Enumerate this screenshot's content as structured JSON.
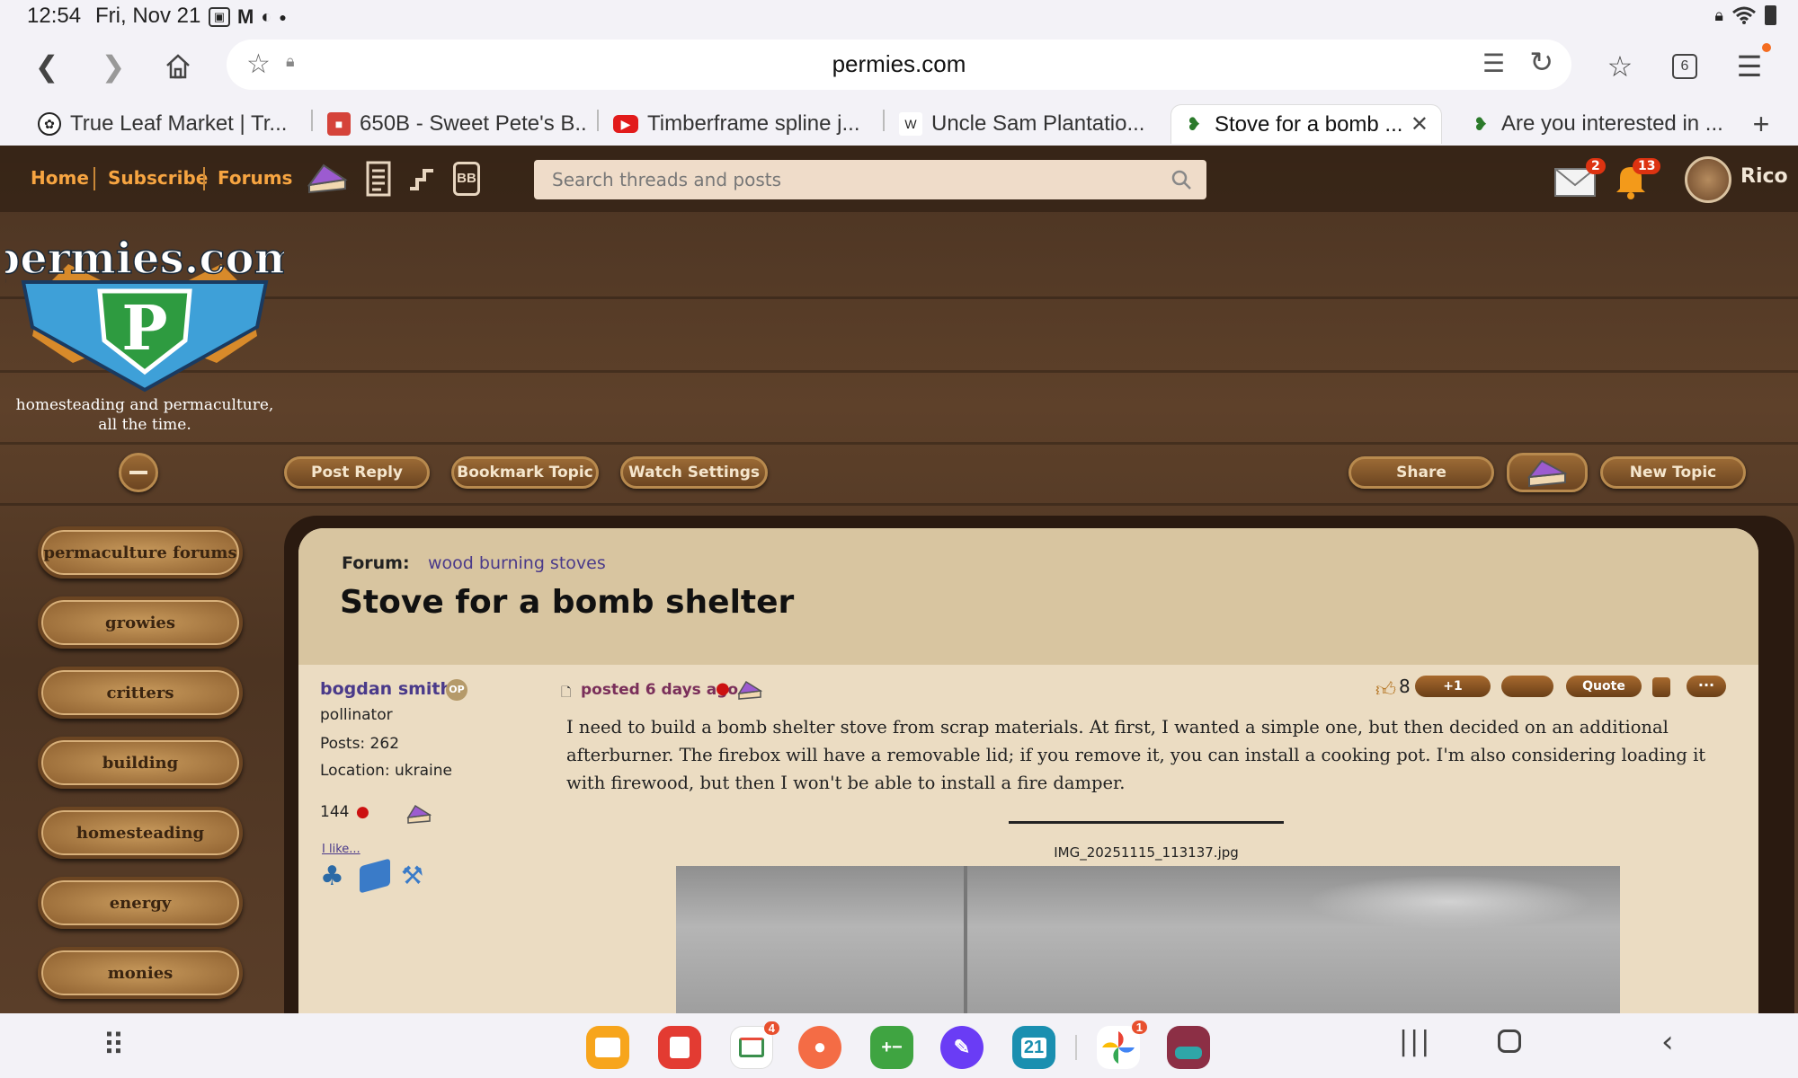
{
  "status_bar": {
    "time": "12:54",
    "date": "Fri, Nov 21",
    "notification_icons": [
      "gallery-icon",
      "gmail-icon",
      "sync-icon",
      "dot-icon"
    ],
    "system_icons": [
      "lock-icon",
      "wifi-icon",
      "battery-icon"
    ]
  },
  "browser": {
    "url": "permies.com",
    "tab_count": "6",
    "tabs": [
      {
        "title": "True Leaf Market | Tr...",
        "icon": "trueleaf-favicon"
      },
      {
        "title": "650B - Sweet Pete's B...",
        "icon": "sweetpete-favicon"
      },
      {
        "title": "Timberframe spline j...",
        "icon": "youtube-favicon"
      },
      {
        "title": "Uncle Sam Plantatio...",
        "icon": "wikipedia-favicon"
      },
      {
        "title": "Stove for a bomb ...",
        "icon": "permies-favicon",
        "active": true
      },
      {
        "title": "Are you interested in ...",
        "icon": "permies-favicon"
      }
    ]
  },
  "site": {
    "nav": {
      "home": "Home",
      "subscribe": "Subscribe",
      "forums": "Forums"
    },
    "search_placeholder": "Search threads and posts",
    "mail_count": "2",
    "notif_count": "13",
    "username": "Rico",
    "logo": {
      "name": "permies.com",
      "tagline1": "homesteading and permaculture,",
      "tagline2": "all the time."
    },
    "actions": {
      "post_reply": "Post Reply",
      "bookmark": "Bookmark Topic",
      "watch": "Watch Settings",
      "share": "Share",
      "new_topic": "New Topic"
    },
    "sidebar": [
      "permaculture forums",
      "growies",
      "critters",
      "building",
      "homesteading",
      "energy",
      "monies"
    ],
    "forum_label": "Forum:",
    "forum_name": "wood burning stoves",
    "topic_title": "Stove for a bomb shelter",
    "post": {
      "author": "bogdan smith",
      "op_badge": "OP",
      "role": "pollinator",
      "posts": "Posts: 262",
      "location": "Location: ukraine",
      "apples": "144",
      "i_like": "I like...",
      "posted": "posted 6 days ago",
      "likes": "8",
      "plus_one": "+1",
      "quote": "Quote",
      "more": "···",
      "body": "I need to build a bomb shelter stove from scrap materials. At first, I wanted a simple one, but then decided on an additional afterburner. The firebox will have a removable lid; if you remove it, you can install a cooking pot. I'm also considering loading it with firewood, but then I won't be able to install a fire damper.",
      "attachment": "IMG_20251115_113137.jpg"
    }
  },
  "taskbar": {
    "apps": [
      {
        "name": "files-app",
        "color": "#f7a51c",
        "badge": ""
      },
      {
        "name": "notes-app",
        "color": "#e33b32",
        "badge": ""
      },
      {
        "name": "calendar-app",
        "color": "#ffffff",
        "badge": "4"
      },
      {
        "name": "contacts-app",
        "color": "#f46c45",
        "badge": ""
      },
      {
        "name": "calculator-app",
        "color": "#3fa441",
        "badge": ""
      },
      {
        "name": "internet-app",
        "color": "#6a3cf5",
        "badge": ""
      },
      {
        "name": "calendar21-app",
        "color": "#1a8fb0",
        "badge": ""
      },
      {
        "name": "photos-app",
        "color": "#ffffff",
        "badge": "1"
      },
      {
        "name": "app-9",
        "color": "#8c2f45",
        "badge": ""
      }
    ],
    "calendar_day": "21"
  }
}
